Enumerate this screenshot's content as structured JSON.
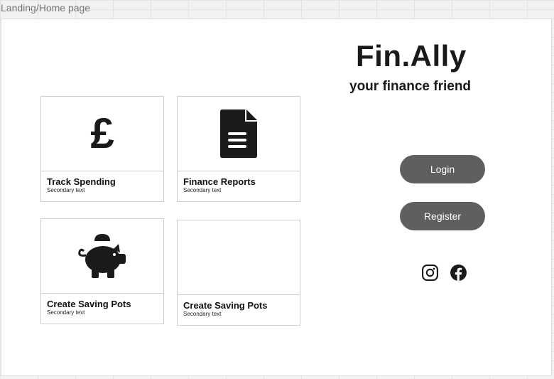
{
  "frame": {
    "label": "Landing/Home page"
  },
  "brand": {
    "name": "Fin.Ally",
    "tagline": "your finance friend"
  },
  "cards": [
    {
      "title": "Track Spending",
      "subtitle": "Secondary text",
      "icon": "pound-icon"
    },
    {
      "title": "Finance Reports",
      "subtitle": "Secondary text",
      "icon": "document-icon"
    },
    {
      "title": "Create Saving Pots",
      "subtitle": "Secondary text",
      "icon": "piggy-bank-icon"
    },
    {
      "title": "Create Saving Pots",
      "subtitle": "Secondary text",
      "icon": ""
    }
  ],
  "actions": {
    "login": "Login",
    "register": "Register"
  },
  "social": [
    "instagram-icon",
    "facebook-icon"
  ],
  "colors": {
    "button": "#5f5f5f",
    "text": "#1a1a1a",
    "canvas": "#f2f2f2"
  }
}
